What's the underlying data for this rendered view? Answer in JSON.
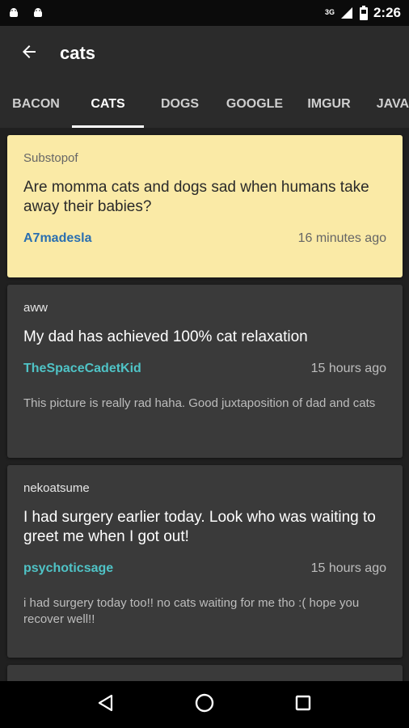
{
  "status_bar": {
    "time": "2:26",
    "network": "3G",
    "icons": [
      "android-icon",
      "android-icon",
      "signal-icon",
      "battery-icon"
    ]
  },
  "app_bar": {
    "title": "cats",
    "back_icon": "arrow-back-icon"
  },
  "tabs": [
    {
      "label": "BACON",
      "active": false
    },
    {
      "label": "CATS",
      "active": true
    },
    {
      "label": "DOGS",
      "active": false
    },
    {
      "label": "GOOGLE",
      "active": false
    },
    {
      "label": "IMGUR",
      "active": false
    },
    {
      "label": "JAVA",
      "active": false
    }
  ],
  "posts": [
    {
      "subreddit": "Substopof",
      "title": "Are momma cats and dogs sad when humans take away their babies?",
      "author": "A7madesla",
      "time": "16 minutes ago",
      "comment": "",
      "highlight": true
    },
    {
      "subreddit": "aww",
      "title": "My dad has achieved 100% cat relaxation",
      "author": "TheSpaceCadetKid",
      "time": "15 hours ago",
      "comment": "This picture is really rad haha. Good juxtaposition of dad and cats",
      "highlight": false
    },
    {
      "subreddit": "nekoatsume",
      "title": "I had surgery earlier today. Look who was waiting to greet me when I got out!",
      "author": "psychoticsage",
      "time": "15 hours ago",
      "comment": "i had surgery today too!! no cats waiting for me tho :( hope you recover well!!",
      "highlight": false
    }
  ],
  "nav_bar": {
    "icons": [
      "back-triangle-icon",
      "home-circle-icon",
      "recents-square-icon"
    ]
  },
  "colors": {
    "highlight_card": "#faeaa6",
    "card": "#3a3a3a",
    "author_teal": "#4fc3c6",
    "author_blue": "#2a6fb0"
  }
}
